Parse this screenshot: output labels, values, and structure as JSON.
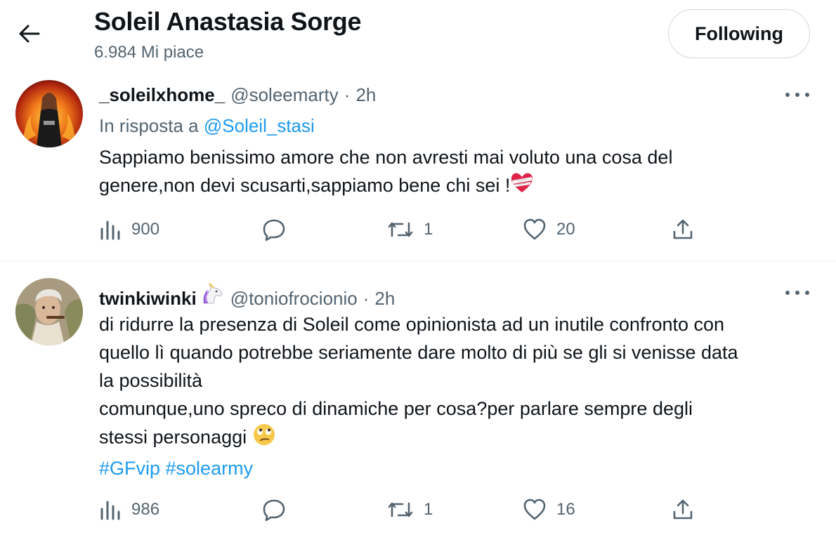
{
  "header": {
    "title": "Soleil Anastasia Sorge",
    "subtitle": "6.984 Mi piace",
    "follow_label": "Following"
  },
  "tweets": [
    {
      "display_name": "_soleilxhome_",
      "handle": "@soleemarty",
      "separator": "·",
      "time": "2h",
      "reply_prefix": "In risposta a",
      "reply_mention": "@Soleil_stasi",
      "lines": [
        "Sappiamo benissimo amore che non avresti mai voluto una cosa del",
        "genere,non devi scusarti,sappiamo bene chi sei !"
      ],
      "emoji": "mending-heart",
      "stats": {
        "views": "900",
        "replies": "",
        "retweets": "1",
        "likes": "20"
      }
    },
    {
      "display_name": "twinkiwinki",
      "name_emoji": "unicorn",
      "handle": "@toniofrocionio",
      "separator": "·",
      "time": "2h",
      "lines": [
        "di ridurre la presenza di Soleil come opinionista ad un inutile confronto con",
        "quello lì quando potrebbe seriamente dare molto di più se gli si venisse data",
        "la possibilità",
        "comunque,uno spreco di dinamiche per cosa?per parlare sempre degli",
        "stessi personaggi"
      ],
      "emoji": "face-with-rolling-eyes",
      "hashtags": "#GFvip #solearmy",
      "stats": {
        "views": "986",
        "replies": "",
        "retweets": "1",
        "likes": "16"
      }
    }
  ],
  "colors": {
    "text": "#0f1419",
    "secondary": "#536471",
    "accent": "#1d9bf0",
    "divider": "#eff3f4",
    "button_border": "#cfd9de"
  },
  "icons": {
    "back": "arrow-left-icon",
    "more": "more-dots-icon",
    "views": "analytics-icon",
    "reply": "reply-icon",
    "retweet": "retweet-icon",
    "like": "heart-icon",
    "share": "share-icon"
  }
}
